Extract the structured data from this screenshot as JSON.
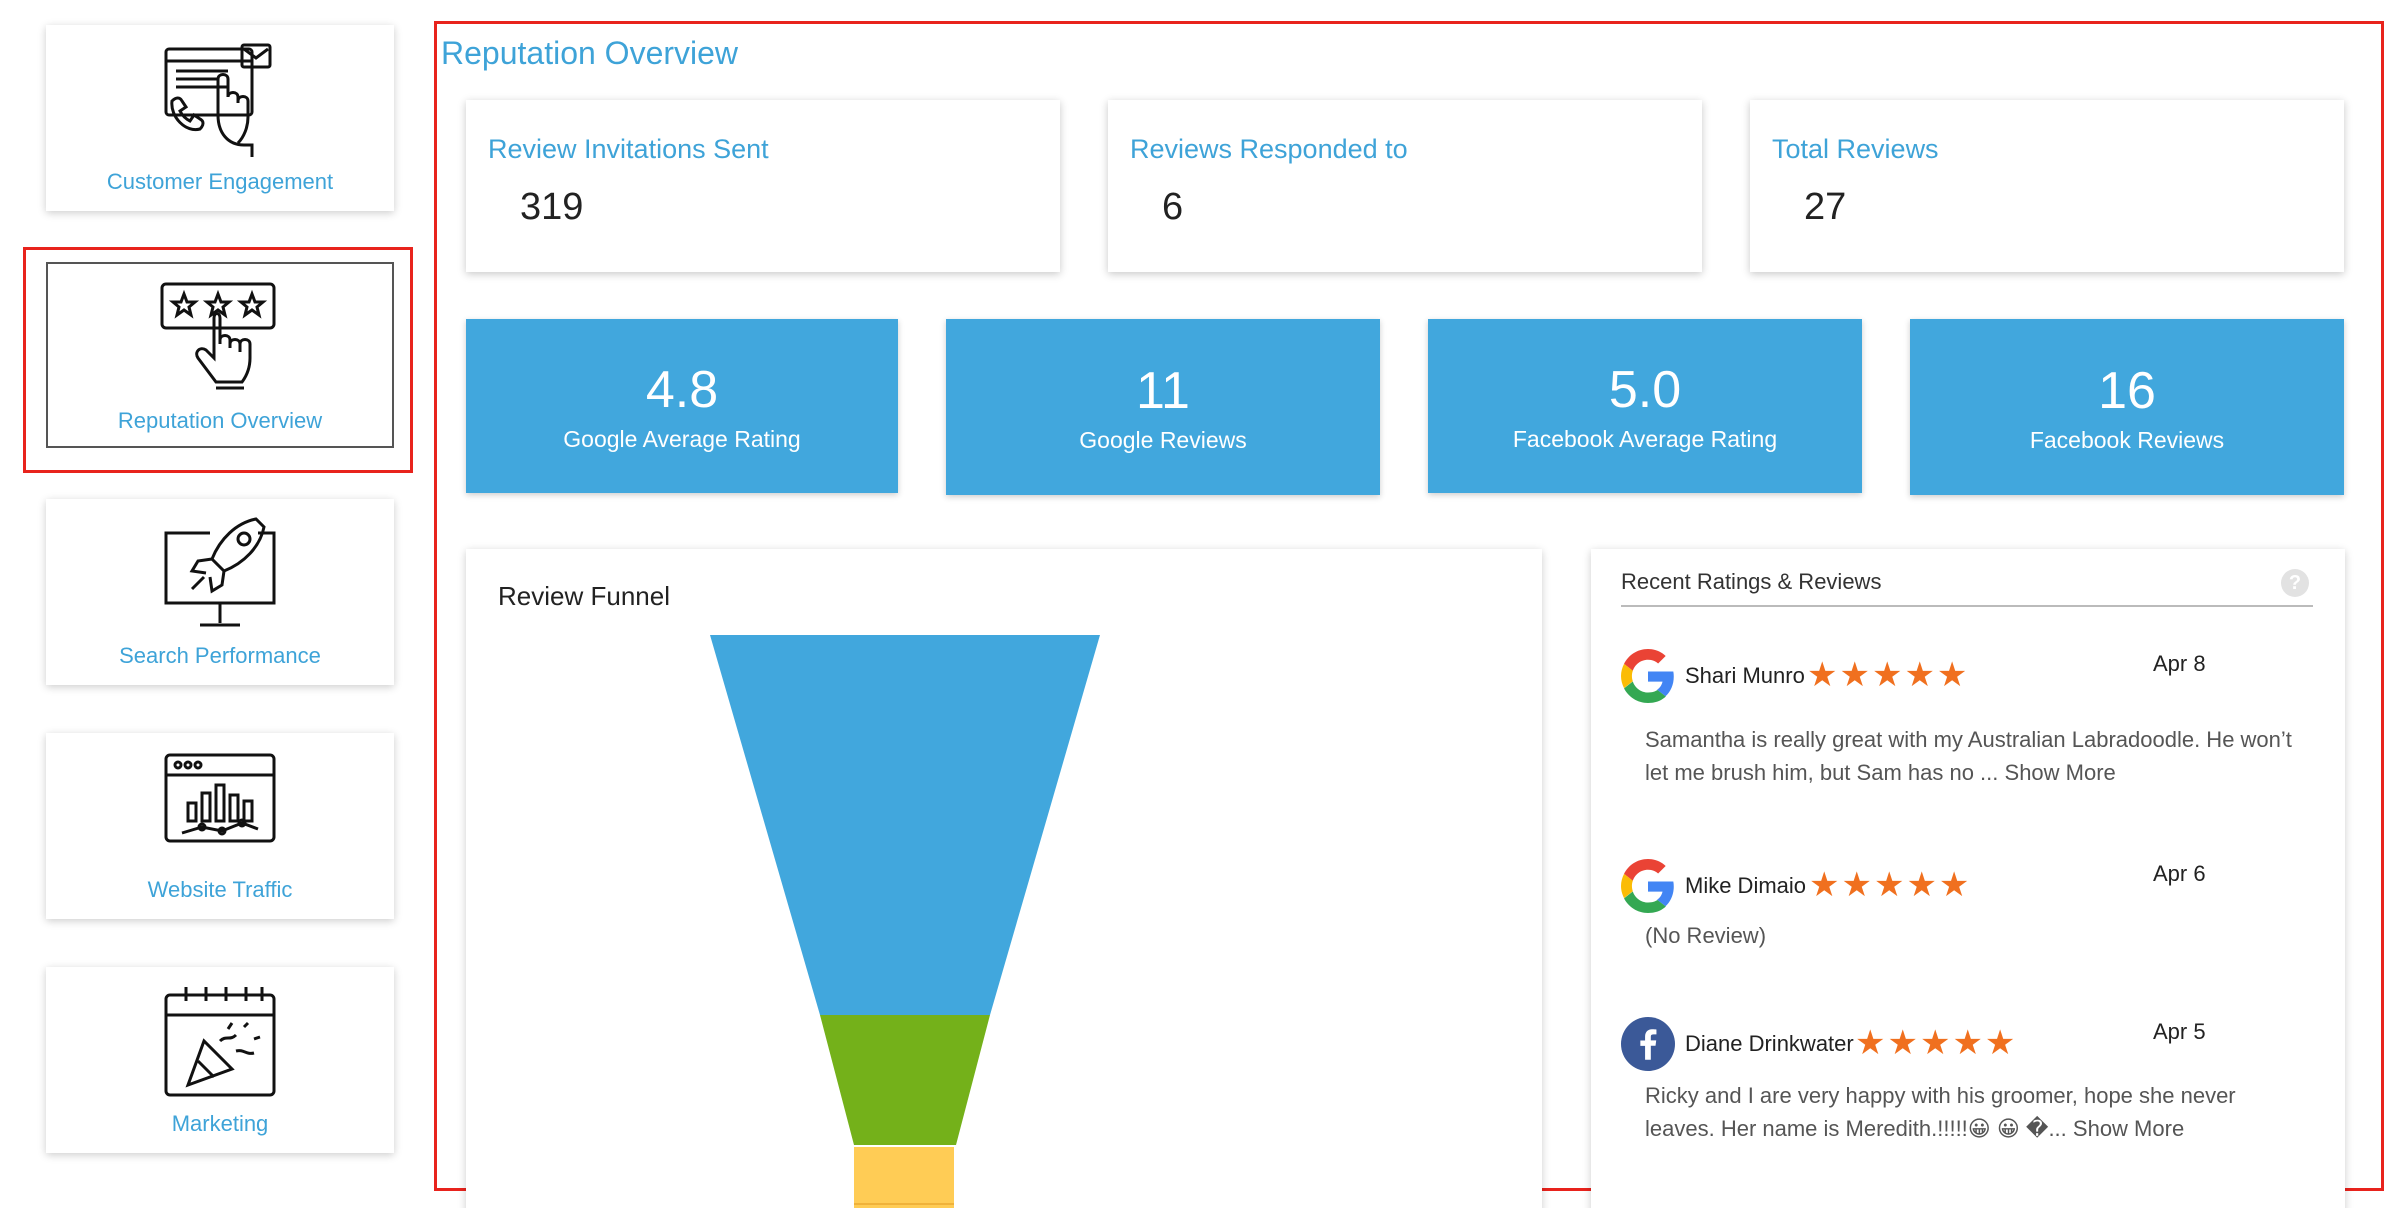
{
  "sidebar": {
    "items": [
      {
        "label": "Customer Engagement",
        "icon": "customer-engagement-icon"
      },
      {
        "label": "Reputation Overview",
        "icon": "rating-stars-hand-icon",
        "active": true
      },
      {
        "label": "Search Performance",
        "icon": "rocket-monitor-icon"
      },
      {
        "label": "Website Traffic",
        "icon": "browser-chart-icon"
      },
      {
        "label": "Marketing",
        "icon": "calendar-party-icon"
      }
    ]
  },
  "page": {
    "title": "Reputation Overview"
  },
  "stats": [
    {
      "label": "Review Invitations Sent",
      "value": "319"
    },
    {
      "label": "Reviews Responded to",
      "value": "6"
    },
    {
      "label": "Total Reviews",
      "value": "27"
    }
  ],
  "tiles": [
    {
      "value": "4.8",
      "label": "Google Average Rating"
    },
    {
      "value": "11",
      "label": "Google Reviews"
    },
    {
      "value": "5.0",
      "label": "Facebook Average Rating"
    },
    {
      "value": "16",
      "label": "Facebook Reviews"
    }
  ],
  "funnel": {
    "title": "Review Funnel",
    "colors": [
      "#41a7dd",
      "#74b11a",
      "#ffcc55"
    ]
  },
  "reviews": {
    "title": "Recent Ratings & Reviews",
    "help": "?",
    "show_more": "Show More",
    "star_color": "#f0701f",
    "items": [
      {
        "source": "google",
        "name": "Shari Munro",
        "stars": 5,
        "date": "Apr 8",
        "text": "Samantha is really great with my Australian Labradoodle. He won’t let me brush him, but Sam has no ...",
        "has_more": true
      },
      {
        "source": "google",
        "name": "Mike Dimaio",
        "stars": 5,
        "date": "Apr 6",
        "text": "(No Review)",
        "has_more": false
      },
      {
        "source": "facebook",
        "name": "Diane Drinkwater",
        "stars": 5,
        "date": "Apr 5",
        "text": "Ricky and I are very happy with his groomer, hope she never leaves. Her name is Meredith.!!!!!😀 😀 �...",
        "has_more": true
      }
    ]
  }
}
